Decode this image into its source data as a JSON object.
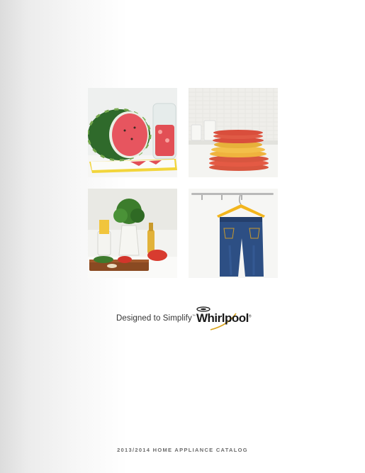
{
  "page": {
    "tiles": [
      {
        "id": "tile-1",
        "subject": "watermelon-on-cutting-board"
      },
      {
        "id": "tile-2",
        "subject": "stacked-dinner-plates"
      },
      {
        "id": "tile-3",
        "subject": "herbs-and-vegetables-kitchen-counter"
      },
      {
        "id": "tile-4",
        "subject": "jeans-on-hanger"
      }
    ],
    "brand": {
      "tagline": "Designed to Simplify",
      "tagline_mark": "™",
      "logo_text": "Whirlpool",
      "logo_mark": "®"
    },
    "footer": {
      "catalog_title": "2013/2014 HOME APPLIANCE CATALOG"
    },
    "colors": {
      "logo_accent": "#d9a31a",
      "footer_text": "#6b6b6b"
    }
  }
}
